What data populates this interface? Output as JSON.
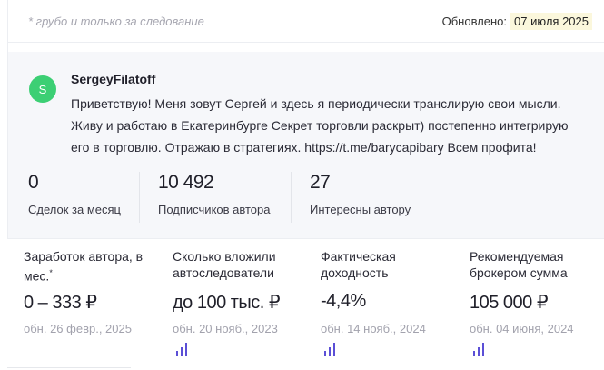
{
  "header": {
    "note": "* грубо и только за следование",
    "updated_label": "Обновлено:",
    "updated_date": "07 июля 2025"
  },
  "author": {
    "avatar_letter": "S",
    "avatar_color": "#3ccf74",
    "name": "SergeyFilatoff",
    "bio": "Приветствую! Меня зовут Сергей и здесь я периодически транслирую свои мысли. Живу и работаю в Екатеринбурге Секрет торговли раскрыт) постепенно интегрирую его в торговлю. Отражаю в стратегиях. https://t.me/barycapibary Всем профита!"
  },
  "stats": [
    {
      "value": "0",
      "label": "Сделок за месяц"
    },
    {
      "value": "10 492",
      "label": "Подписчиков автора"
    },
    {
      "value": "27",
      "label": "Интересны автору"
    }
  ],
  "metrics": [
    {
      "title": "Заработок автора, в мес.",
      "title_sup": "*",
      "value": "0 – 333 ₽",
      "updated": "обн. 26 февр., 2025",
      "has_chart_icon": false
    },
    {
      "title": "Сколько вложили автоследователи",
      "value": "до 100 тыс. ₽",
      "updated": "обн. 20 нояб., 2023",
      "has_chart_icon": true
    },
    {
      "title": "Фактическая доходность",
      "value": "-4,4%",
      "updated": "обн. 14 нояб., 2024",
      "has_chart_icon": true
    },
    {
      "title": "Рекомендуемая брокером сумма",
      "value": "105 000 ₽",
      "updated": "обн. 04 июня, 2024",
      "has_chart_icon": true
    }
  ],
  "colors": {
    "accent_icon": "#5b4fd6",
    "date_highlight": "#fbf7dc"
  }
}
